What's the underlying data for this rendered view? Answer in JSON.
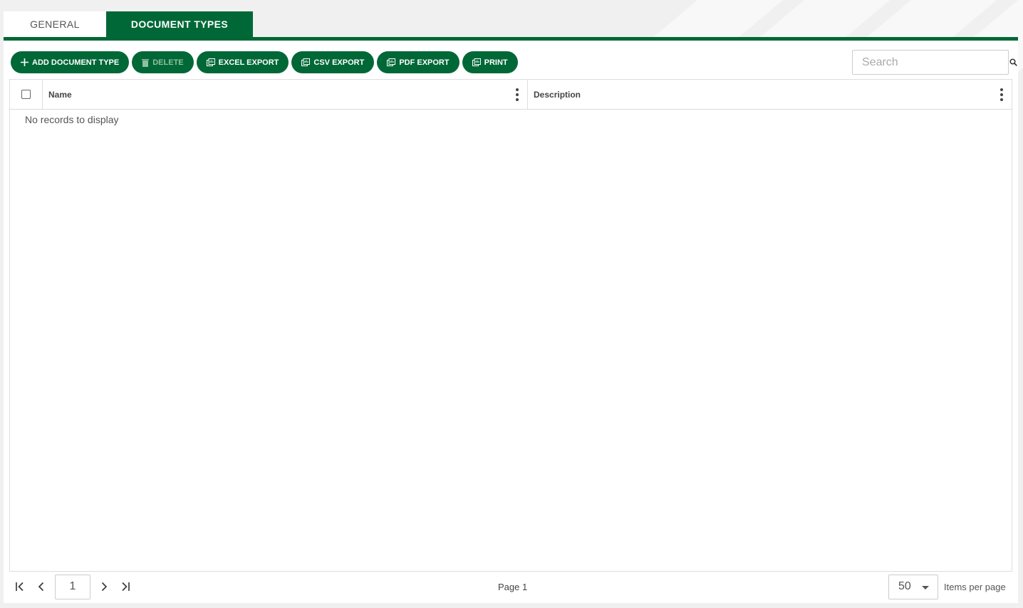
{
  "tabs": [
    {
      "label": "GENERAL",
      "active": false
    },
    {
      "label": "DOCUMENT TYPES",
      "active": true
    }
  ],
  "toolbar": {
    "add_label": "ADD DOCUMENT TYPE",
    "delete_label": "DELETE",
    "excel_label": "EXCEL EXPORT",
    "csv_label": "CSV EXPORT",
    "pdf_label": "PDF EXPORT",
    "print_label": "PRINT"
  },
  "search": {
    "placeholder": "Search",
    "value": ""
  },
  "grid": {
    "columns": [
      "Name",
      "Description"
    ],
    "empty_text": "No records to display"
  },
  "pager": {
    "current_page": "1",
    "page_label": "Page 1",
    "items_per_page": "50",
    "items_per_page_label": "Items per page"
  },
  "colors": {
    "brand": "#006837"
  }
}
